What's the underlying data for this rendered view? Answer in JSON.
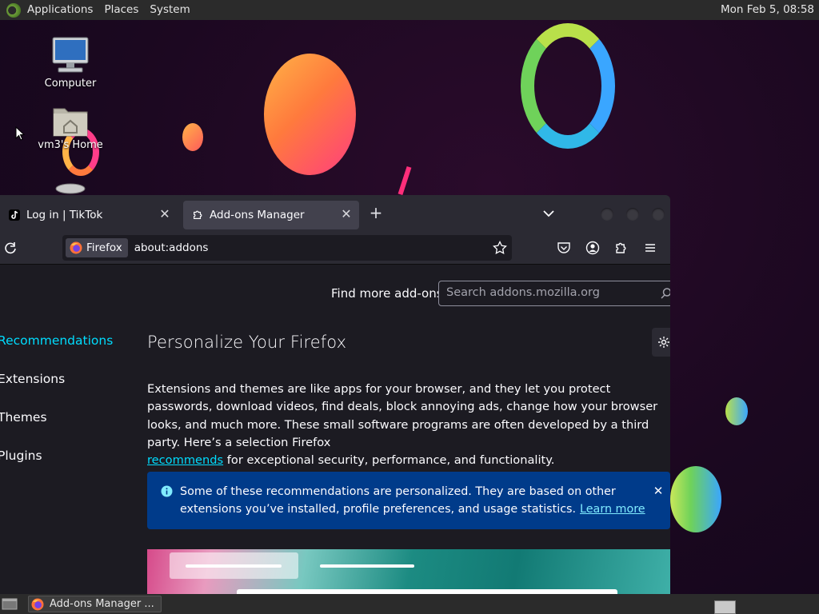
{
  "top_panel": {
    "menus": [
      "Applications",
      "Places",
      "System"
    ],
    "clock": "Mon Feb  5, 08:58"
  },
  "desktop": {
    "icons": [
      {
        "label": "Computer",
        "icon": "computer-icon"
      },
      {
        "label": "vm3's Home",
        "icon": "home-folder-icon"
      },
      {
        "label": "",
        "icon": "trash-icon"
      }
    ]
  },
  "browser": {
    "tabs": [
      {
        "title": "Log in | TikTok",
        "icon": "tiktok-icon",
        "active": false
      },
      {
        "title": "Add-ons Manager",
        "icon": "puzzle-icon",
        "active": true
      }
    ],
    "identity_label": "Firefox",
    "url": "about:addons",
    "find_more_label": "Find more add-ons",
    "search_placeholder": "Search addons.mozilla.org",
    "categories": [
      {
        "label": "Recommendations",
        "selected": true
      },
      {
        "label": "Extensions",
        "selected": false
      },
      {
        "label": "Themes",
        "selected": false
      },
      {
        "label": "Plugins",
        "selected": false
      }
    ],
    "heading": "Personalize Your Firefox",
    "intro_text": "Extensions and themes are like apps for your browser, and they let you protect passwords, download videos, find deals, block annoying ads, change how your browser looks, and much more. These small software programs are often developed by a third party. Here’s a selection Firefox",
    "intro_link": "recommends",
    "intro_tail": " for exceptional security, performance, and functionality.",
    "info_message": "Some of these recommendations are personalized. They are based on other extensions you’ve installed, profile preferences, and usage statistics.",
    "info_link": "Learn more"
  },
  "taskbar": {
    "window_button": "Add-ons Manager ..."
  },
  "colors": {
    "accent": "#00ddff",
    "info_bg": "#003b8a",
    "panel": "#2b2b2b",
    "browser_bg": "#1c1b22",
    "toolbar": "#2b2a33"
  }
}
